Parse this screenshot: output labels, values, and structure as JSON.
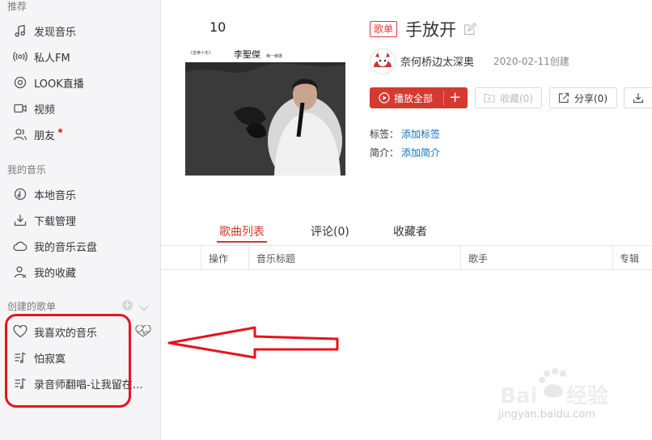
{
  "sidebar": {
    "recommend_title": "推荐",
    "recommend_items": [
      {
        "label": "发现音乐",
        "icon": "music-note-icon"
      },
      {
        "label": "私人FM",
        "icon": "radio-icon"
      },
      {
        "label": "LOOK直播",
        "icon": "live-icon"
      },
      {
        "label": "视频",
        "icon": "video-icon"
      },
      {
        "label": "朋友",
        "icon": "friends-icon"
      }
    ],
    "mymusic_title": "我的音乐",
    "mymusic_items": [
      {
        "label": "本地音乐",
        "icon": "local-music-icon"
      },
      {
        "label": "下载管理",
        "icon": "download-icon"
      },
      {
        "label": "我的音乐云盘",
        "icon": "cloud-icon"
      },
      {
        "label": "我的收藏",
        "icon": "collection-icon"
      }
    ],
    "created_title": "创建的歌单",
    "playlists": [
      {
        "label": "我喜欢的音乐",
        "icon": "heart-icon"
      },
      {
        "label": "怕寂寞",
        "icon": "playlist-icon"
      },
      {
        "label": "录音师翻唱-让我留在你...",
        "icon": "playlist-icon"
      }
    ]
  },
  "playlist": {
    "badge": "歌单",
    "title": "手放开",
    "creator": "奈何桥边太深奥",
    "created": "2020-02-11创建",
    "play_all": "播放全部",
    "collect": "收藏(0)",
    "share": "分享(0)",
    "tags_label": "标签：",
    "tags_link": "添加标签",
    "intro_label": "简介：",
    "intro_link": "添加简介",
    "cover_text": {
      "number": "10",
      "artist": "李聖傑",
      "subtitle": "《音樂十年》",
      "suffix": "唯一精選"
    }
  },
  "tabs": [
    {
      "label": "歌曲列表",
      "active": true
    },
    {
      "label": "评论(0)",
      "active": false
    },
    {
      "label": "收藏者",
      "active": false
    }
  ],
  "table_headers": [
    "操作",
    "音乐标题",
    "歌手",
    "专辑"
  ],
  "watermark": {
    "text": "jingyan.baidu.com"
  },
  "colors": {
    "accent": "#d33a31",
    "link": "#0c73c2",
    "annotation": "#e8121b"
  }
}
